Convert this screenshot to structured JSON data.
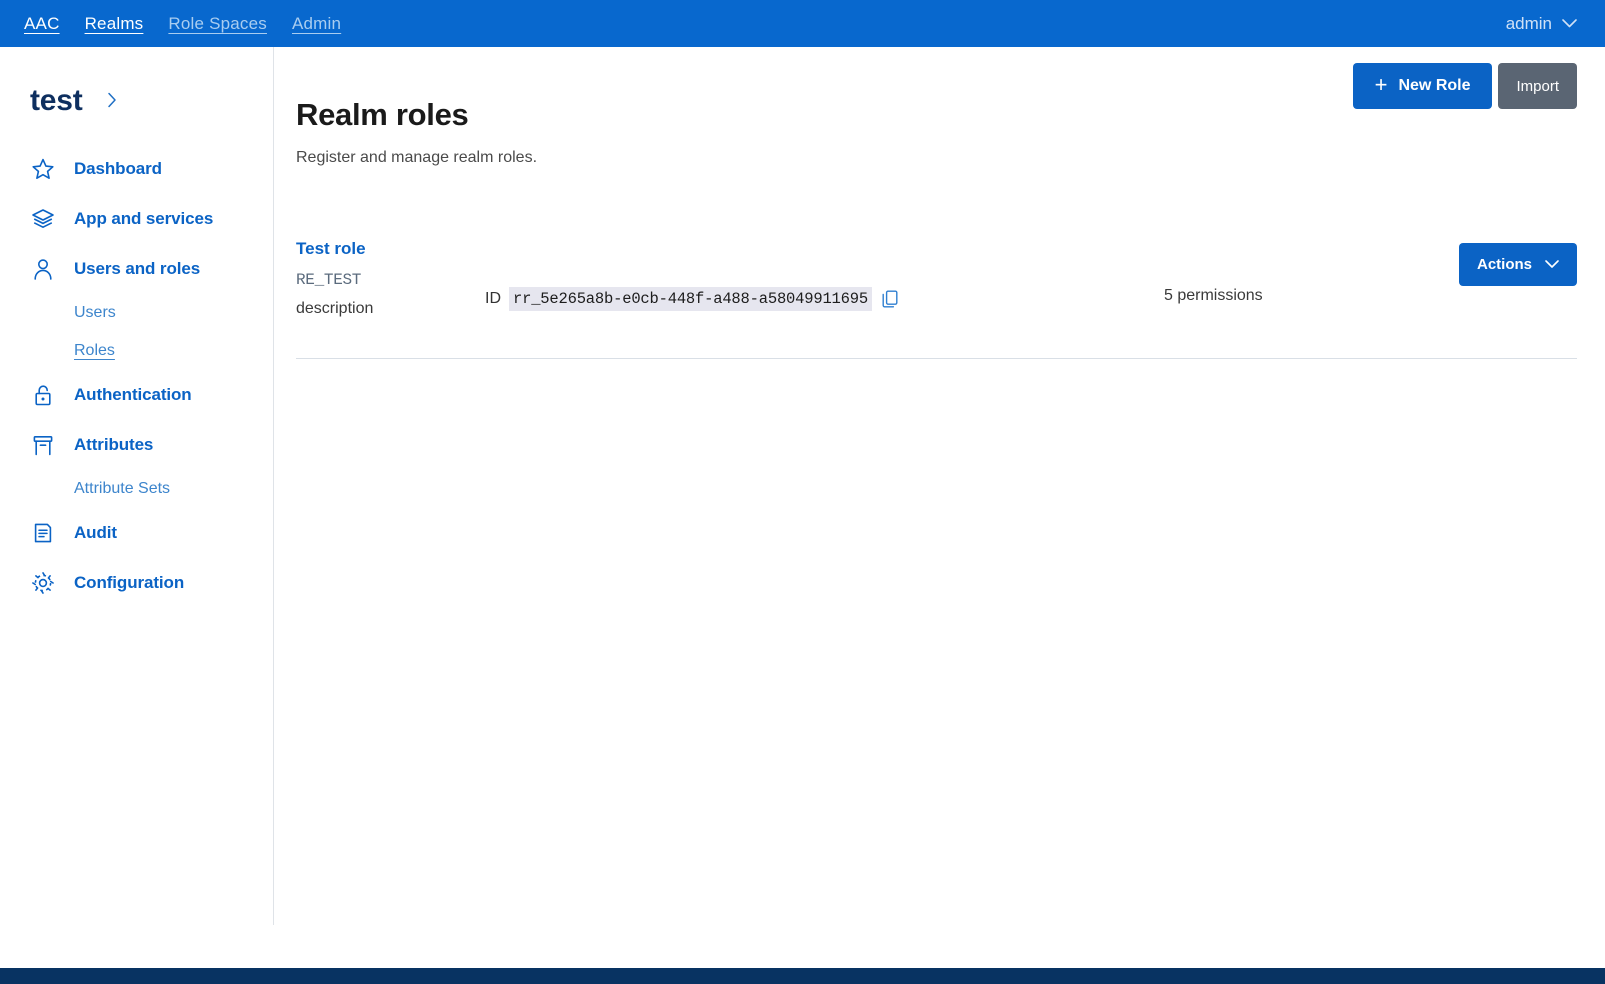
{
  "topbar": {
    "links": [
      {
        "label": "AAC",
        "state": "active"
      },
      {
        "label": "Realms",
        "state": "active"
      },
      {
        "label": "Role Spaces",
        "state": "muted"
      },
      {
        "label": "Admin",
        "state": "muted"
      }
    ],
    "user": "admin",
    "user_chevron_icon": "chevron-down-icon",
    "background_color": "#0868ce"
  },
  "sidebar": {
    "realm": {
      "name": "test",
      "chevron_icon": "chevron-right-icon"
    },
    "items": [
      {
        "label": "Dashboard",
        "icon": "star-icon"
      },
      {
        "label": "App and services",
        "icon": "layers-icon"
      },
      {
        "label": "Users and roles",
        "icon": "user-icon"
      },
      {
        "label": "Users",
        "icon": "none",
        "sub": true
      },
      {
        "label": "Roles",
        "icon": "none",
        "sub": true,
        "active": true
      },
      {
        "label": "Authentication",
        "icon": "lock-icon"
      },
      {
        "label": "Attributes",
        "icon": "archive-icon"
      },
      {
        "label": "Attribute Sets",
        "icon": "none",
        "sub": true
      },
      {
        "label": "Audit",
        "icon": "document-icon"
      },
      {
        "label": "Configuration",
        "icon": "gear-icon"
      }
    ],
    "accent_color": "#0b63c5"
  },
  "page": {
    "title": "Realm roles",
    "subtitle": "Register and manage realm roles.",
    "new_role_label": "New Role",
    "new_role_icon": "plus-icon",
    "import_label": "Import"
  },
  "roles": [
    {
      "name": "Test role",
      "authority": "RE_TEST",
      "description": "description",
      "id_label": "ID",
      "id_value": "rr_5e265a8b-e0cb-448f-a488-a58049911695",
      "copy_icon": "copy-icon",
      "permissions": "5 permissions",
      "actions_label": "Actions",
      "actions_chevron_icon": "chevron-down-icon"
    }
  ],
  "footer": {
    "background_color": "#083362"
  }
}
